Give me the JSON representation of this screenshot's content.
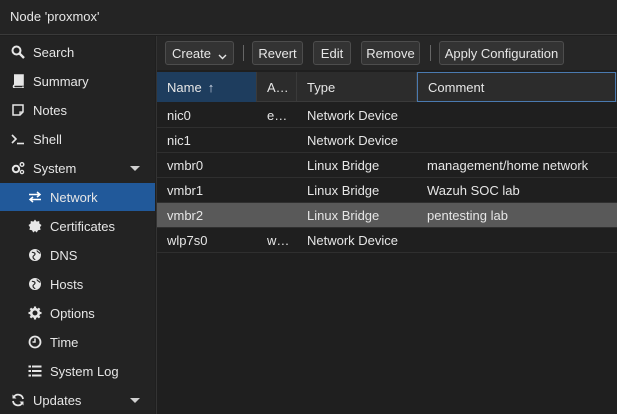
{
  "window": {
    "title": "Node 'proxmox'"
  },
  "sidebar": {
    "items": [
      {
        "label": "Search"
      },
      {
        "label": "Summary"
      },
      {
        "label": "Notes"
      },
      {
        "label": "Shell"
      },
      {
        "label": "System"
      },
      {
        "label": "Network"
      },
      {
        "label": "Certificates"
      },
      {
        "label": "DNS"
      },
      {
        "label": "Hosts"
      },
      {
        "label": "Options"
      },
      {
        "label": "Time"
      },
      {
        "label": "System Log"
      },
      {
        "label": "Updates"
      }
    ]
  },
  "toolbar": {
    "create": "Create",
    "revert": "Revert",
    "edit": "Edit",
    "remove": "Remove",
    "apply": "Apply Configuration"
  },
  "grid": {
    "columns": [
      "Name",
      "A…",
      "Type",
      "Comment"
    ],
    "sort_indicator": "↑",
    "rows": [
      {
        "name": "nic0",
        "active": "e…",
        "type": "Network Device",
        "comment": ""
      },
      {
        "name": "nic1",
        "active": "",
        "type": "Network Device",
        "comment": ""
      },
      {
        "name": "vmbr0",
        "active": "",
        "type": "Linux Bridge",
        "comment": "management/home network"
      },
      {
        "name": "vmbr1",
        "active": "",
        "type": "Linux Bridge",
        "comment": "Wazuh SOC lab"
      },
      {
        "name": "vmbr2",
        "active": "",
        "type": "Linux Bridge",
        "comment": "pentesting lab"
      },
      {
        "name": "wlp7s0",
        "active": "w…",
        "type": "Network Device",
        "comment": ""
      }
    ]
  },
  "colors": {
    "selected_nav": "#21599a",
    "selected_row": "#595959",
    "sorted_header": "#1e3d5e"
  }
}
